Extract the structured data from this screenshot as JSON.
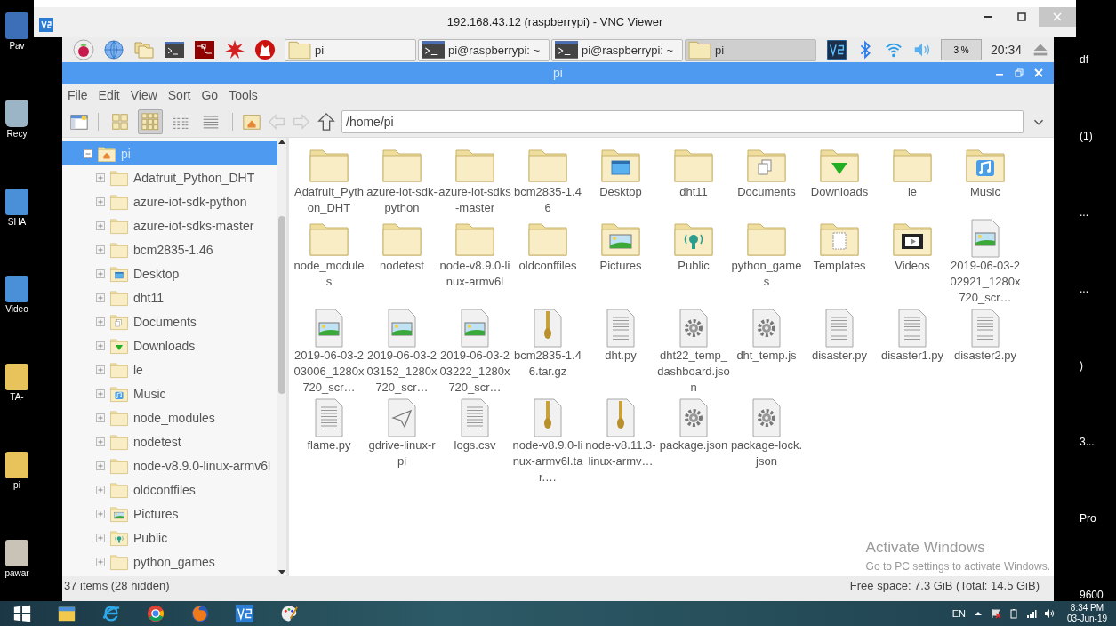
{
  "desktop": {
    "left_icons": [
      {
        "label": "Pav",
        "kind": "computer"
      },
      {
        "label": "Recy",
        "kind": "bin"
      },
      {
        "label": "SHA",
        "kind": "app"
      },
      {
        "label": "Video",
        "kind": "app"
      },
      {
        "label": "TA-",
        "kind": "folder"
      },
      {
        "label": "pi",
        "kind": "folder"
      },
      {
        "label": "pawar",
        "kind": "photo"
      }
    ],
    "right_labels": [
      "df",
      "(1)",
      "...",
      "...",
      ")",
      "3...",
      "Pro",
      "9600"
    ]
  },
  "vnc_window": {
    "title": "192.168.43.12 (raspberrypi) - VNC Viewer"
  },
  "pi_panel": {
    "taskbar_buttons": [
      {
        "label": "pi",
        "kind": "folder",
        "selected": false
      },
      {
        "label": "pi@raspberrypi: ~",
        "kind": "terminal",
        "selected": false
      },
      {
        "label": "pi@raspberrypi: ~",
        "kind": "terminal",
        "selected": false
      },
      {
        "label": "pi",
        "kind": "folder",
        "selected": true
      }
    ],
    "cpu": "3 %",
    "clock": "20:34"
  },
  "file_manager": {
    "title": "pi",
    "menu": [
      "File",
      "Edit",
      "View",
      "Sort",
      "Go",
      "Tools"
    ],
    "view_modes": [
      {
        "kind": "thumbnails",
        "selected": false
      },
      {
        "kind": "icons",
        "selected": true
      },
      {
        "kind": "compact",
        "selected": false
      },
      {
        "kind": "list",
        "selected": false
      }
    ],
    "navigation": [
      {
        "kind": "back",
        "disabled": true
      },
      {
        "kind": "forward",
        "disabled": true
      },
      {
        "kind": "up",
        "disabled": false
      }
    ],
    "path": "/home/pi",
    "tree": {
      "label": "pi",
      "kind": "home",
      "expanded": true,
      "selected": true,
      "children": [
        {
          "label": "Adafruit_Python_DHT",
          "kind": "folder",
          "expanded": false,
          "selected": false
        },
        {
          "label": "azure-iot-sdk-python",
          "kind": "folder",
          "expanded": false,
          "selected": false
        },
        {
          "label": "azure-iot-sdks-master",
          "kind": "folder",
          "expanded": false,
          "selected": false
        },
        {
          "label": "bcm2835-1.46",
          "kind": "folder",
          "expanded": false,
          "selected": false
        },
        {
          "label": "Desktop",
          "kind": "desktop",
          "expanded": false,
          "selected": false
        },
        {
          "label": "dht11",
          "kind": "folder",
          "expanded": false,
          "selected": false
        },
        {
          "label": "Documents",
          "kind": "documents",
          "expanded": false,
          "selected": false
        },
        {
          "label": "Downloads",
          "kind": "downloads",
          "expanded": false,
          "selected": false
        },
        {
          "label": "le",
          "kind": "folder",
          "expanded": false,
          "selected": false
        },
        {
          "label": "Music",
          "kind": "music",
          "expanded": false,
          "selected": false
        },
        {
          "label": "node_modules",
          "kind": "folder",
          "expanded": false,
          "selected": false
        },
        {
          "label": "nodetest",
          "kind": "folder",
          "expanded": false,
          "selected": false
        },
        {
          "label": "node-v8.9.0-linux-armv6l",
          "kind": "folder",
          "expanded": false,
          "selected": false
        },
        {
          "label": "oldconffiles",
          "kind": "folder",
          "expanded": false,
          "selected": false
        },
        {
          "label": "Pictures",
          "kind": "pictures",
          "expanded": false,
          "selected": false
        },
        {
          "label": "Public",
          "kind": "public",
          "expanded": false,
          "selected": false
        },
        {
          "label": "python_games",
          "kind": "folder",
          "expanded": false,
          "selected": false
        }
      ]
    },
    "files": [
      {
        "name": "Adafruit_Python_DHT",
        "kind": "folder"
      },
      {
        "name": "azure-iot-sdk-python",
        "kind": "folder"
      },
      {
        "name": "azure-iot-sdks-master",
        "kind": "folder"
      },
      {
        "name": "bcm2835-1.46",
        "kind": "folder"
      },
      {
        "name": "Desktop",
        "kind": "desktop"
      },
      {
        "name": "dht11",
        "kind": "folder"
      },
      {
        "name": "Documents",
        "kind": "documents"
      },
      {
        "name": "Downloads",
        "kind": "downloads"
      },
      {
        "name": "le",
        "kind": "folder"
      },
      {
        "name": "Music",
        "kind": "music"
      },
      {
        "name": "node_modules",
        "kind": "folder"
      },
      {
        "name": "nodetest",
        "kind": "folder"
      },
      {
        "name": "node-v8.9.0-linux-armv6l",
        "kind": "folder"
      },
      {
        "name": "oldconffiles",
        "kind": "folder"
      },
      {
        "name": "Pictures",
        "kind": "pictures"
      },
      {
        "name": "Public",
        "kind": "public"
      },
      {
        "name": "python_games",
        "kind": "folder"
      },
      {
        "name": "Templates",
        "kind": "templates"
      },
      {
        "name": "Videos",
        "kind": "videos"
      },
      {
        "name": "2019-06-03-202921_1280x720_scr…",
        "kind": "image"
      },
      {
        "name": "2019-06-03-203006_1280x720_scr…",
        "kind": "image"
      },
      {
        "name": "2019-06-03-203152_1280x720_scr…",
        "kind": "image"
      },
      {
        "name": "2019-06-03-203222_1280x720_scr…",
        "kind": "image"
      },
      {
        "name": "bcm2835-1.46.tar.gz",
        "kind": "archive"
      },
      {
        "name": "dht.py",
        "kind": "text"
      },
      {
        "name": "dht22_temp_dashboard.json",
        "kind": "config"
      },
      {
        "name": "dht_temp.js",
        "kind": "config"
      },
      {
        "name": "disaster.py",
        "kind": "text"
      },
      {
        "name": "disaster1.py",
        "kind": "text"
      },
      {
        "name": "disaster2.py",
        "kind": "text"
      },
      {
        "name": "flame.py",
        "kind": "text"
      },
      {
        "name": "gdrive-linux-rpi",
        "kind": "executable"
      },
      {
        "name": "logs.csv",
        "kind": "text"
      },
      {
        "name": "node-v8.9.0-linux-armv6l.tar.…",
        "kind": "archive"
      },
      {
        "name": "node-v8.11.3-linux-armv…",
        "kind": "archive"
      },
      {
        "name": "package.json",
        "kind": "config"
      },
      {
        "name": "package-lock.json",
        "kind": "config"
      }
    ],
    "status_left": "37 items (28 hidden)",
    "status_right": "Free space: 7.3 GiB (Total: 14.5 GiB)"
  },
  "activation": {
    "title": "Activate Windows",
    "subtitle": "Go to PC settings to activate Windows."
  },
  "windows_taskbar": {
    "language": "EN",
    "time": "8:34 PM",
    "date": "03-Jun-19"
  }
}
